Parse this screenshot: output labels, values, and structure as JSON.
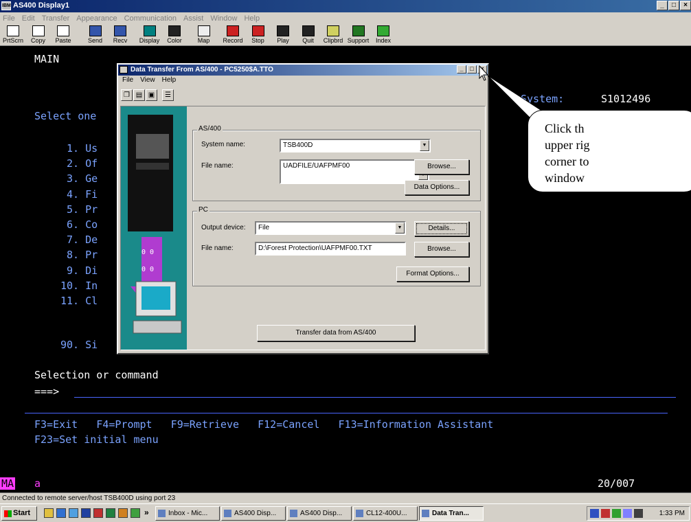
{
  "window": {
    "title": "AS400 Display1",
    "icon_label": "IBM",
    "minimize": "_",
    "restore": "□",
    "close": "×"
  },
  "menu": [
    "File",
    "Edit",
    "Transfer",
    "Appearance",
    "Communication",
    "Assist",
    "Window",
    "Help"
  ],
  "toolbar": [
    {
      "label": "PrtScrn",
      "icon": "print-screen-icon",
      "color": "#ffffff"
    },
    {
      "label": "Copy",
      "icon": "copy-icon",
      "color": "#ffffff"
    },
    {
      "label": "Paste",
      "icon": "paste-icon",
      "color": "#ffffff"
    },
    {
      "label": "Send",
      "icon": "send-icon",
      "color": "#3355aa"
    },
    {
      "label": "Recv",
      "icon": "receive-icon",
      "color": "#3355aa"
    },
    {
      "label": "Display",
      "icon": "display-icon",
      "color": "#008080"
    },
    {
      "label": "Color",
      "icon": "color-icon",
      "color": "#222222"
    },
    {
      "label": "Map",
      "icon": "map-icon",
      "color": "#eeeeee"
    },
    {
      "label": "Record",
      "icon": "record-icon",
      "color": "#cc2222"
    },
    {
      "label": "Stop",
      "icon": "stop-icon",
      "color": "#cc2222"
    },
    {
      "label": "Play",
      "icon": "play-icon",
      "color": "#222222"
    },
    {
      "label": "Quit",
      "icon": "quit-icon",
      "color": "#222222"
    },
    {
      "label": "Clipbrd",
      "icon": "clipboard-icon",
      "color": "#d0d060"
    },
    {
      "label": "Support",
      "icon": "support-globe-icon",
      "color": "#227722"
    },
    {
      "label": "Index",
      "icon": "index-icon",
      "color": "#33aa33"
    }
  ],
  "terminal": {
    "title": "MAIN",
    "system_label": "System:",
    "system_value": "S1012496",
    "prompt": "Select one",
    "options": [
      {
        "num": " 1.",
        "text": "Us"
      },
      {
        "num": " 2.",
        "text": "Of"
      },
      {
        "num": " 3.",
        "text": "Ge"
      },
      {
        "num": " 4.",
        "text": "Fi"
      },
      {
        "num": " 5.",
        "text": "Pr"
      },
      {
        "num": " 6.",
        "text": "Co"
      },
      {
        "num": " 7.",
        "text": "De"
      },
      {
        "num": " 8.",
        "text": "Pr"
      },
      {
        "num": " 9.",
        "text": "Di"
      },
      {
        "num": "10.",
        "text": "In"
      },
      {
        "num": "11.",
        "text": "Cl"
      }
    ],
    "option_90": {
      "num": "90.",
      "text": "Si"
    },
    "selection_label": "Selection or command",
    "command_prompt": "===>",
    "fkeys_line1": "F3=Exit   F4=Prompt   F9=Retrieve   F12=Cancel   F13=Information Assistant",
    "fkeys_line2": "F23=Set initial menu"
  },
  "status": {
    "indicator": "MA",
    "field": "a",
    "position": "20/007"
  },
  "connection_status": "Connected to remote server/host TSB400D using port 23",
  "dialog": {
    "title": "Data Transfer From AS/400 - PC5250$A.TTO",
    "menu": [
      "File",
      "View",
      "Help"
    ],
    "tools": [
      {
        "name": "new-icon",
        "glyph": "❐"
      },
      {
        "name": "open-folder-icon",
        "glyph": "▤"
      },
      {
        "name": "save-icon",
        "glyph": "▣"
      },
      {
        "name": "properties-icon",
        "glyph": "☰"
      }
    ],
    "as400": {
      "legend": "AS/400",
      "system_label": "System name:",
      "system_value": "TSB400D",
      "file_label": "File name:",
      "file_value": "UADFILE/UAFPMF00",
      "browse": "Browse...",
      "data_options": "Data Options..."
    },
    "pc": {
      "legend": "PC",
      "output_label": "Output device:",
      "output_value": "File",
      "details": "Details...",
      "file_label": "File name:",
      "file_value": "D:\\Forest Protection\\UAFPMF00.TXT",
      "browse": "Browse...",
      "format_options": "Format Options..."
    },
    "transfer_button": "Transfer data from AS/400"
  },
  "callout": {
    "lines": [
      "Click th",
      "upper rig",
      "corner to",
      "window"
    ]
  },
  "taskbar": {
    "start": "Start",
    "chevron": "»",
    "items": [
      {
        "label": "Inbox - Mic...",
        "active": false
      },
      {
        "label": "AS400 Disp...",
        "active": false
      },
      {
        "label": "AS400 Disp...",
        "active": false
      },
      {
        "label": "CL12-400U...",
        "active": false
      },
      {
        "label": "Data Tran...",
        "active": true
      }
    ],
    "clock": "1:33 PM"
  }
}
